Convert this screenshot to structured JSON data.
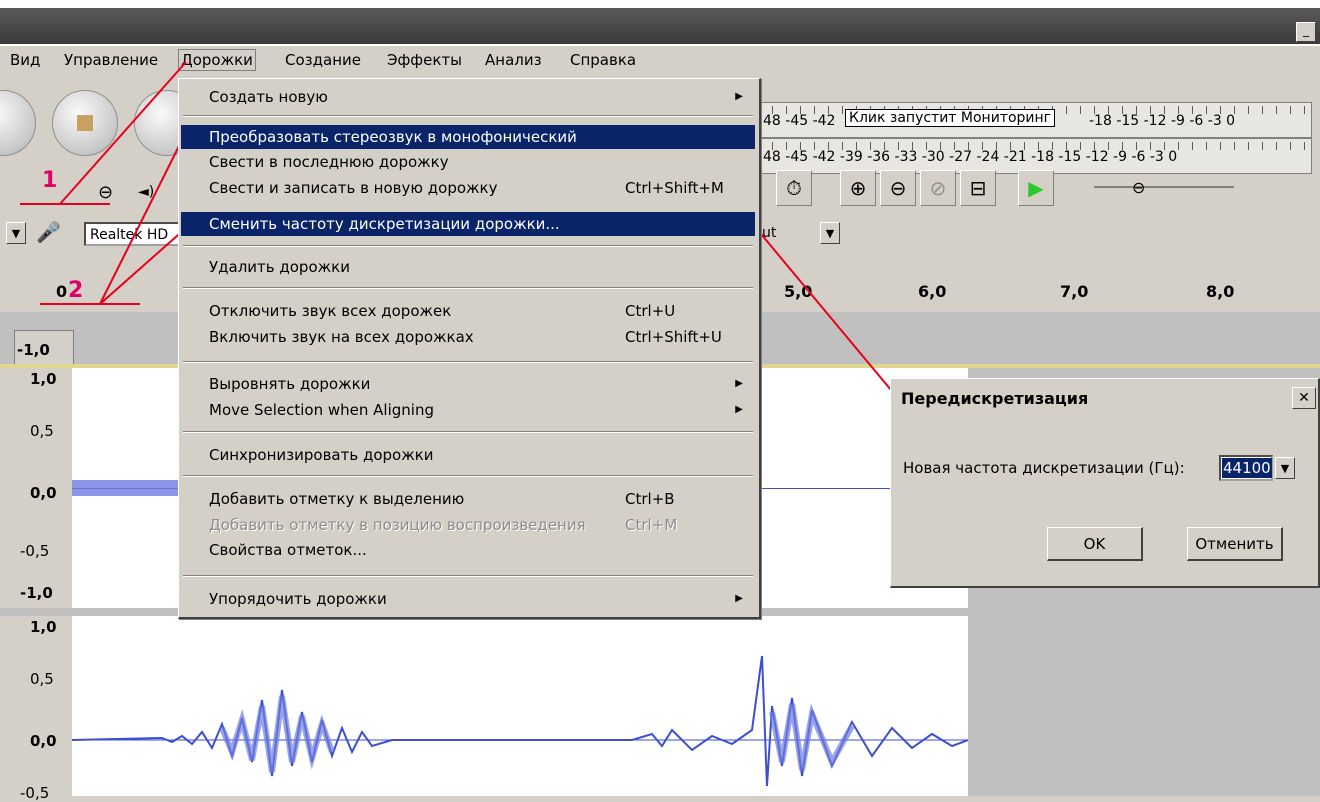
{
  "menubar": {
    "items": [
      "Вид",
      "Управление",
      "Дорожки",
      "Создание",
      "Эффекты",
      "Анализ",
      "Справка"
    ]
  },
  "meter": {
    "top_scale": "48 -45 -42",
    "top_tooltip": "Клик запустит Мониторинг",
    "top_scale_right": "-18 -15 -12 -9 -6 -3 0",
    "bottom_scale": "48 -45 -42 -39 -36 -33 -30 -27 -24 -21 -18 -15 -12 -9 -6 -3 0"
  },
  "devices": {
    "input_device": "Realtek HD",
    "output_device": "ut"
  },
  "ruler": {
    "labels": [
      "0",
      "5,0",
      "6,0",
      "7,0",
      "8,0"
    ]
  },
  "tracks": {
    "top_label": "-1,0",
    "t1": [
      "1,0",
      "0,5",
      "0,0",
      "-0,5",
      "-1,0"
    ],
    "t2": [
      "1,0",
      "0,5",
      "0,0",
      "-0,5"
    ]
  },
  "dropdown": {
    "create_new": "Создать новую",
    "stereo_to_mono": "Преобразовать стереозвук в монофонический",
    "mix_last": "Свести в последнюю дорожку",
    "mix_new": "Свести и записать в новую дорожку",
    "mix_new_sc": "Ctrl+Shift+M",
    "resample": "Сменить частоту дискретизации дорожки...",
    "remove": "Удалить дорожки",
    "mute_all": "Отключить звук всех дорожек",
    "mute_all_sc": "Ctrl+U",
    "unmute_all": "Включить звук на всех дорожках",
    "unmute_all_sc": "Ctrl+Shift+U",
    "align": "Выровнять дорожки",
    "move_sel": "Move Selection when Aligning",
    "sync": "Синхронизировать дорожки",
    "add_label_sel": "Добавить отметку к выделению",
    "add_label_sel_sc": "Ctrl+B",
    "add_label_play": "Добавить отметку в позицию воспроизведения",
    "add_label_play_sc": "Ctrl+M",
    "label_props": "Свойства отметок...",
    "sort": "Упорядочить дорожки"
  },
  "dialog": {
    "title": "Передискретизация",
    "close": "✕",
    "label": "Новая частота дискретизации (Гц):",
    "value": "44100",
    "ok": "OK",
    "cancel": "Отменить"
  },
  "annotations": {
    "one": "1",
    "two": "2"
  },
  "colors": {
    "highlight": "#0a246a",
    "wave": "#3c4fd0",
    "annotation": "#e8001c"
  }
}
